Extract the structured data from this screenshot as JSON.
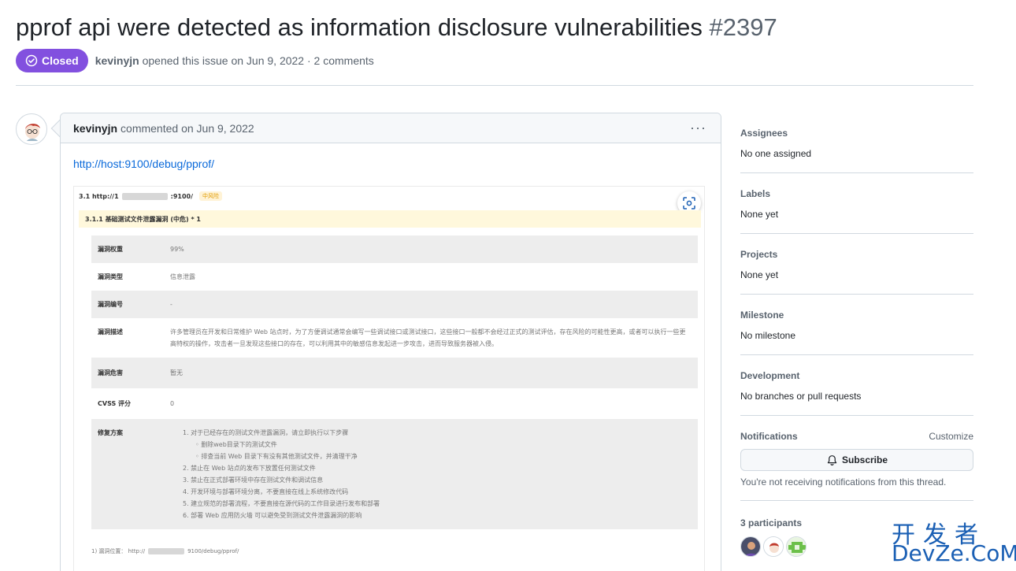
{
  "issue": {
    "title": "pprof api were detected as information disclosure vulnerabilities",
    "number": "#2397",
    "state": "Closed",
    "author": "kevinyjn",
    "meta_suffix": "opened this issue on Jun 9, 2022 · 2 comments"
  },
  "comment": {
    "author": "kevinyjn",
    "meta": "commented on Jun 9, 2022",
    "menu": "···",
    "link": "http://host:9100/debug/pprof/"
  },
  "report": {
    "heading_prefix": "3.1 http://1",
    "heading_suffix": ":9100/",
    "risk_tag": "中风险",
    "subheading": "3.1.1 基础测试文件泄露漏洞 (中危) * 1",
    "rows": [
      {
        "key": "漏洞权重",
        "value": "99%"
      },
      {
        "key": "漏洞类型",
        "value": "信息泄露"
      },
      {
        "key": "漏洞编号",
        "value": "-"
      },
      {
        "key": "漏洞描述",
        "value": "许多管理员在开发和日常维护 Web 站点时，为了方便调试通常会编写一些调试接口或测试接口，这些接口一般都不会经过正式的测试评估，存在风险的可能性更高，或者可以执行一些更高特权的操作，攻击者一旦发现这些接口的存在，可以利用其中的敏感信息发起进一步攻击，进而导致服务器被入侵。"
      },
      {
        "key": "漏洞危害",
        "value": "暂无"
      },
      {
        "key": "CVSS 评分",
        "value": "0"
      },
      {
        "key": "修复方案",
        "value": ""
      }
    ],
    "fix_steps": [
      "1. 对于已经存在的测试文件泄露漏洞，请立即执行以下步骤",
      "删除web目录下的测试文件",
      "排查当前 Web 目录下有没有其他测试文件，并清理干净",
      "2. 禁止在 Web 站点的发布下放置任何测试文件",
      "3. 禁止在正式部署环境中存在测试文件和调试信息",
      "4. 开发环境与部署环境分离，不要直接在线上系统修改代码",
      "5. 建立规范的部署流程，不要直接在源代码的工作目录进行发布和部署",
      "6. 部署 Web 应用防火墙 可以避免受到测试文件泄露漏洞的影响"
    ],
    "footer_prefix": "1) 漏洞位置： http://",
    "footer_suffix": "9100/debug/pprof/"
  },
  "sidebar": {
    "assignees": {
      "label": "Assignees",
      "value": "No one assigned"
    },
    "labels": {
      "label": "Labels",
      "value": "None yet"
    },
    "projects": {
      "label": "Projects",
      "value": "None yet"
    },
    "milestone": {
      "label": "Milestone",
      "value": "No milestone"
    },
    "development": {
      "label": "Development",
      "value": "No branches or pull requests"
    },
    "notifications": {
      "label": "Notifications",
      "customize": "Customize",
      "subscribe": "Subscribe",
      "note": "You're not receiving notifications from this thread."
    },
    "participants": {
      "label": "3 participants"
    }
  },
  "watermark": {
    "cn": "开发者",
    "en": "DevZe.CoM"
  },
  "colors": {
    "closed_badge": "#8250df",
    "link": "#0969da",
    "border": "#d1d9e0",
    "header_bg": "#f6f8fa"
  },
  "icons": [
    "issue-closed-icon",
    "kebab-icon",
    "scan-icon",
    "bell-icon",
    "avatar"
  ]
}
